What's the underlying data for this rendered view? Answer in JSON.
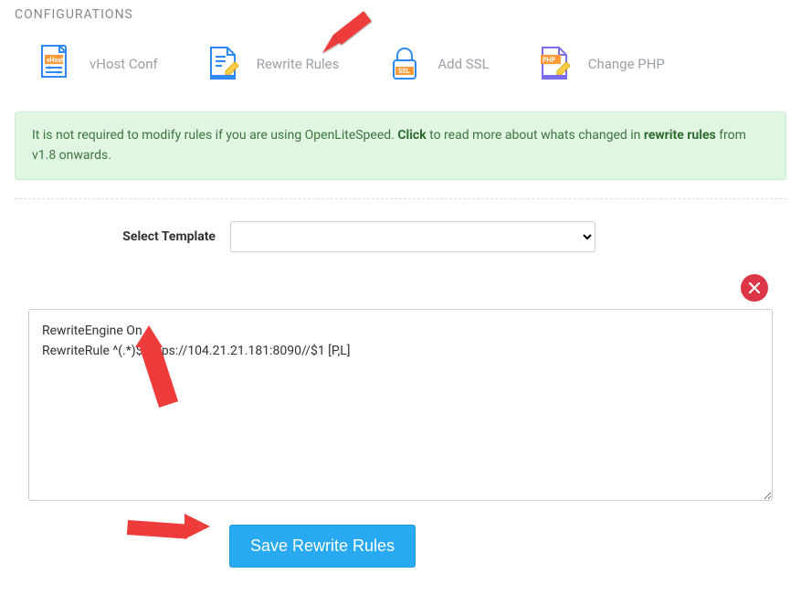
{
  "section_title": "CONFIGURATIONS",
  "tabs": {
    "vhost": "vHost Conf",
    "rewrite": "Rewrite Rules",
    "ssl": "Add SSL",
    "php": "Change PHP"
  },
  "alert": {
    "part1": "It is not required to modify rules if you are using OpenLiteSpeed. ",
    "click": "Click",
    "part2": " to read more about whats changed in ",
    "bold": "rewrite rules",
    "part3": " from v1.8 onwards."
  },
  "form": {
    "select_template_label": "Select Template",
    "select_template_value": "",
    "rules_text": "RewriteEngine On\nRewriteRule ^(.*)$ https://104.21.21.181:8090//$1 [P,L]"
  },
  "buttons": {
    "save": "Save Rewrite Rules"
  }
}
